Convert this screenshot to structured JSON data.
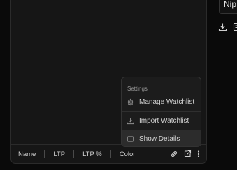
{
  "side_field": {
    "text": "Nip"
  },
  "menu": {
    "section_label": "Settings",
    "items": [
      {
        "label": "Manage Watchlist",
        "icon": "gear-icon"
      },
      {
        "label": "Import Watchlist",
        "icon": "download-icon"
      },
      {
        "label": "Show Details",
        "icon": "details-icon",
        "highlighted": true
      }
    ]
  },
  "footer": {
    "columns": [
      "Name",
      "LTP",
      "LTP %",
      "Color"
    ],
    "icons": [
      "link-icon",
      "external-link-icon",
      "more-vertical-icon"
    ]
  },
  "side_icons": [
    "download-icon",
    "document-icon"
  ]
}
